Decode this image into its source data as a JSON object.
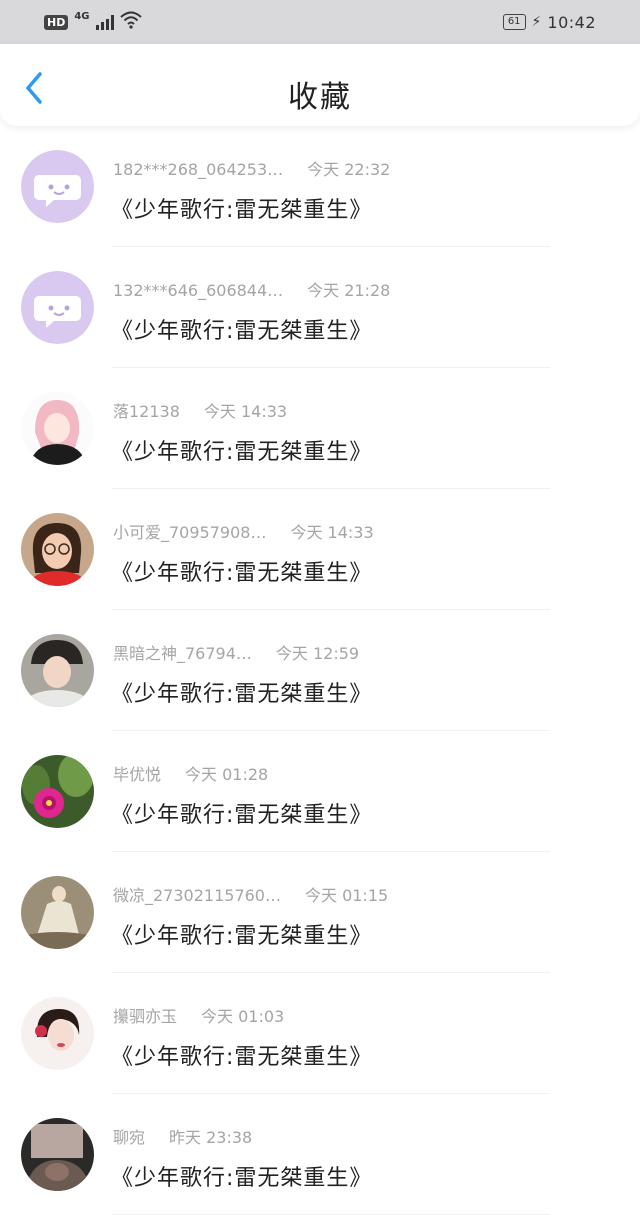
{
  "status_bar": {
    "hd": "HD",
    "network": "4G",
    "battery": "61",
    "time": "10:42"
  },
  "header": {
    "title": "收藏",
    "back_icon": "chevron-left-icon"
  },
  "colors": {
    "accent": "#2b9af3",
    "default_avatar_bg": "#d9c8f0"
  },
  "items": [
    {
      "user": "182***268_064253…",
      "time": "今天 22:32",
      "title": "《少年歌行:雷无桀重生》",
      "avatar": "default-chat-avatar"
    },
    {
      "user": "132***646_606844…",
      "time": "今天 21:28",
      "title": "《少年歌行:雷无桀重生》",
      "avatar": "default-chat-avatar"
    },
    {
      "user": "落12138",
      "time": "今天 14:33",
      "title": "《少年歌行:雷无桀重生》",
      "avatar": "anime-girl-avatar"
    },
    {
      "user": "小可爱_70957908…",
      "time": "今天 14:33",
      "title": "《少年歌行:雷无桀重生》",
      "avatar": "girl-glasses-avatar"
    },
    {
      "user": "黑暗之神_76794…",
      "time": "今天 12:59",
      "title": "《少年歌行:雷无桀重生》",
      "avatar": "girl-hat-avatar"
    },
    {
      "user": "毕优悦",
      "time": "今天 01:28",
      "title": "《少年歌行:雷无桀重生》",
      "avatar": "cactus-flower-avatar"
    },
    {
      "user": "微凉_27302115760…",
      "time": "今天 01:15",
      "title": "《少年歌行:雷无桀重生》",
      "avatar": "dancer-avatar"
    },
    {
      "user": "攥驷亦玉",
      "time": "今天 01:03",
      "title": "《少年歌行:雷无桀重生》",
      "avatar": "woman-portrait-avatar"
    },
    {
      "user": "聊宛",
      "time": "昨天 23:38",
      "title": "《少年歌行:雷无桀重生》",
      "avatar": "dark-photo-avatar"
    }
  ]
}
